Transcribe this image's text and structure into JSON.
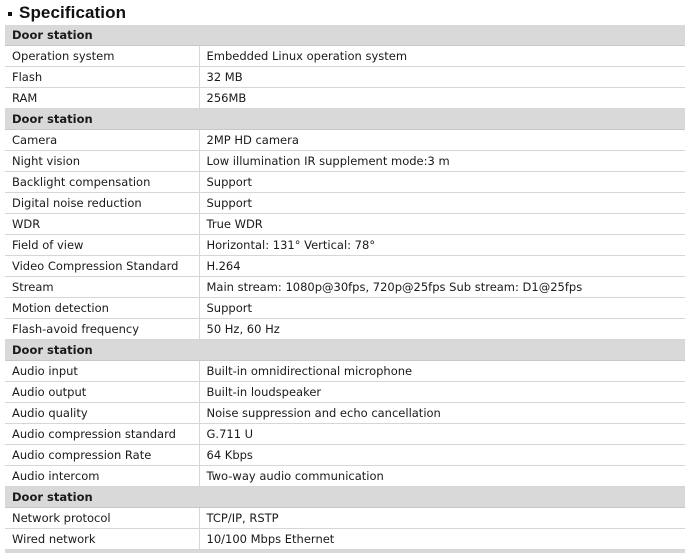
{
  "heading": {
    "bullet_icon": "square-bullet-icon",
    "title": "Specification"
  },
  "sections": [
    {
      "header": "Door station",
      "rows": [
        {
          "label": "Operation system",
          "value": "Embedded Linux operation system"
        },
        {
          "label": "Flash",
          "value": "32 MB"
        },
        {
          "label": "RAM",
          "value": "256MB"
        }
      ]
    },
    {
      "header": "Door station",
      "rows": [
        {
          "label": "Camera",
          "value": "2MP HD camera"
        },
        {
          "label": "Night vision",
          "value": "Low illumination IR supplement mode:3 m"
        },
        {
          "label": "Backlight compensation",
          "value": "Support"
        },
        {
          "label": "Digital noise reduction",
          "value": "Support"
        },
        {
          "label": "WDR",
          "value": "True WDR"
        },
        {
          "label": "Field of view",
          "value": "Horizontal: 131° Vertical: 78°"
        },
        {
          "label": "Video Compression Standard",
          "value": "H.264"
        },
        {
          "label": "Stream",
          "value": "Main stream: 1080p@30fps, 720p@25fps Sub stream: D1@25fps"
        },
        {
          "label": "Motion detection",
          "value": "Support"
        },
        {
          "label": "Flash-avoid frequency",
          "value": "50 Hz, 60 Hz"
        }
      ]
    },
    {
      "header": "Door station",
      "rows": [
        {
          "label": "Audio input",
          "value": "Built-in omnidirectional microphone"
        },
        {
          "label": "Audio output",
          "value": "Built-in loudspeaker"
        },
        {
          "label": "Audio quality",
          "value": "Noise suppression and echo cancellation"
        },
        {
          "label": "Audio compression standard",
          "value": "G.711 U"
        },
        {
          "label": "Audio compression Rate",
          "value": "64 Kbps"
        },
        {
          "label": "Audio intercom",
          "value": "Two-way audio communication"
        }
      ]
    },
    {
      "header": "Door station",
      "rows": [
        {
          "label": "Network protocol",
          "value": "TCP/IP, RSTP"
        },
        {
          "label": "Wired network",
          "value": "10/100 Mbps Ethernet"
        }
      ]
    }
  ]
}
